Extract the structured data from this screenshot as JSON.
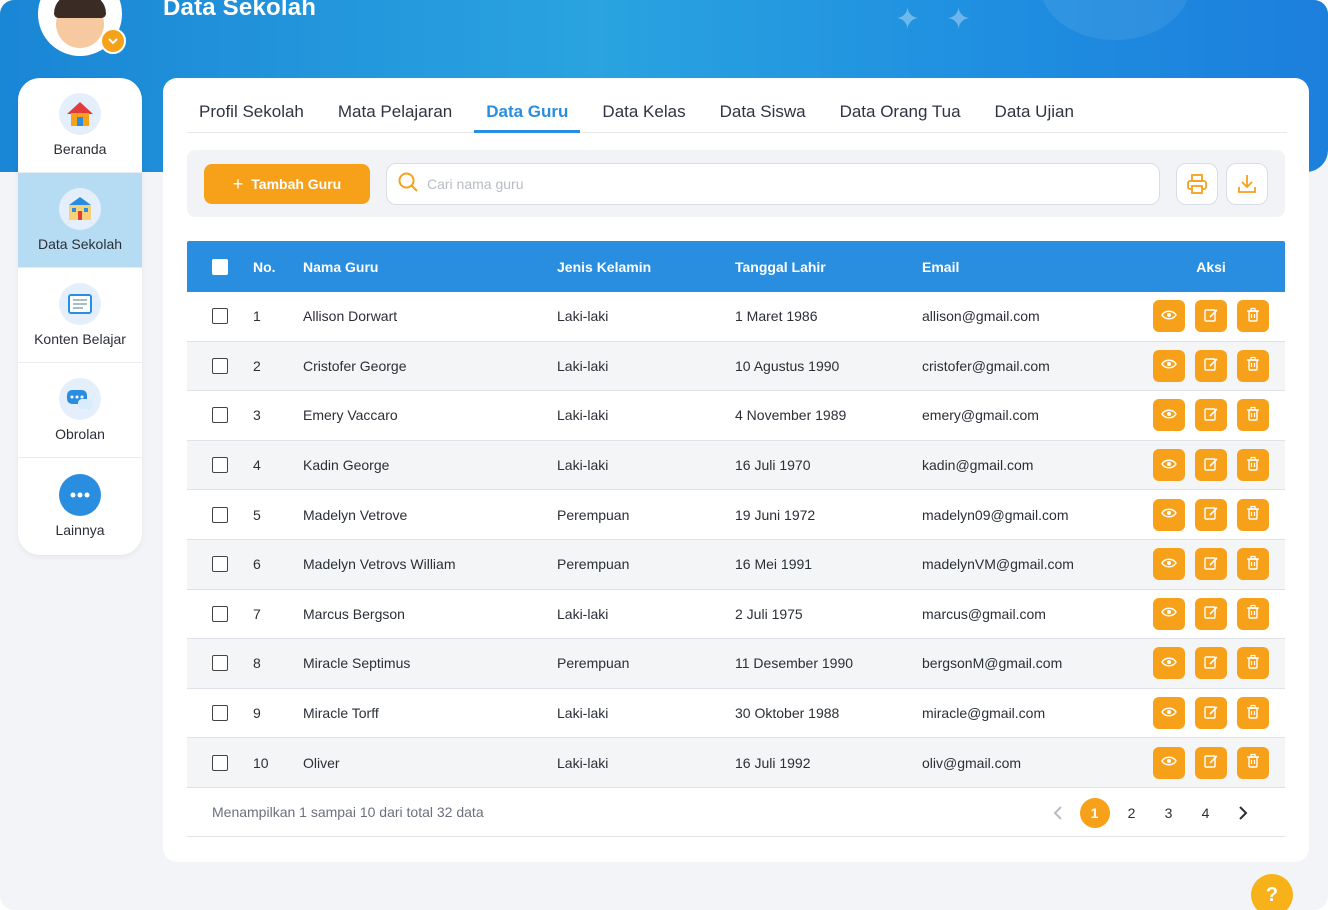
{
  "header": {
    "title": "Data Sekolah"
  },
  "sidebar": {
    "items": [
      {
        "label": "Beranda",
        "icon": "home-icon"
      },
      {
        "label": "Data Sekolah",
        "icon": "school-icon"
      },
      {
        "label": "Konten Belajar",
        "icon": "book-icon"
      },
      {
        "label": "Obrolan",
        "icon": "chat-icon"
      },
      {
        "label": "Lainnya",
        "icon": "more-icon"
      }
    ],
    "active_index": 1
  },
  "tabs": [
    {
      "label": "Profil Sekolah"
    },
    {
      "label": "Mata Pelajaran"
    },
    {
      "label": "Data Guru"
    },
    {
      "label": "Data Kelas"
    },
    {
      "label": "Data Siswa"
    },
    {
      "label": "Data Orang Tua"
    },
    {
      "label": "Data Ujian"
    }
  ],
  "active_tab": 2,
  "toolbar": {
    "add_label": "Tambah Guru",
    "search_placeholder": "Cari nama guru"
  },
  "table": {
    "headers": {
      "no": "No.",
      "name": "Nama Guru",
      "gender": "Jenis Kelamin",
      "dob": "Tanggal Lahir",
      "email": "Email",
      "actions": "Aksi"
    },
    "rows": [
      {
        "no": "1",
        "name": "Allison Dorwart",
        "gender": "Laki-laki",
        "dob": "1 Maret 1986",
        "email": "allison@gmail.com"
      },
      {
        "no": "2",
        "name": "Cristofer George",
        "gender": "Laki-laki",
        "dob": "10 Agustus 1990",
        "email": "cristofer@gmail.com"
      },
      {
        "no": "3",
        "name": "Emery Vaccaro",
        "gender": "Laki-laki",
        "dob": "4 November 1989",
        "email": "emery@gmail.com"
      },
      {
        "no": "4",
        "name": "Kadin George",
        "gender": "Laki-laki",
        "dob": "16 Juli 1970",
        "email": "kadin@gmail.com"
      },
      {
        "no": "5",
        "name": "Madelyn Vetrove",
        "gender": "Perempuan",
        "dob": "19 Juni 1972",
        "email": "madelyn09@gmail.com"
      },
      {
        "no": "6",
        "name": "Madelyn Vetrovs William",
        "gender": "Perempuan",
        "dob": "16 Mei 1991",
        "email": "madelynVM@gmail.com"
      },
      {
        "no": "7",
        "name": "Marcus Bergson",
        "gender": "Laki-laki",
        "dob": "2 Juli 1975",
        "email": "marcus@gmail.com"
      },
      {
        "no": "8",
        "name": "Miracle Septimus",
        "gender": "Perempuan",
        "dob": "11 Desember 1990",
        "email": "bergsonM@gmail.com"
      },
      {
        "no": "9",
        "name": "Miracle Torff",
        "gender": "Laki-laki",
        "dob": "30 Oktober 1988",
        "email": "miracle@gmail.com"
      },
      {
        "no": "10",
        "name": "Oliver",
        "gender": "Laki-laki",
        "dob": "16 Juli 1992",
        "email": "oliv@gmail.com"
      }
    ]
  },
  "pagination": {
    "info": "Menampilkan 1 sampai 10 dari total 32 data",
    "pages": [
      "1",
      "2",
      "3",
      "4"
    ],
    "current": "1"
  },
  "help_label": "?",
  "colors": {
    "primary": "#2a8ee0",
    "accent": "#f7a11a",
    "active_side": "#b6dcf3"
  }
}
